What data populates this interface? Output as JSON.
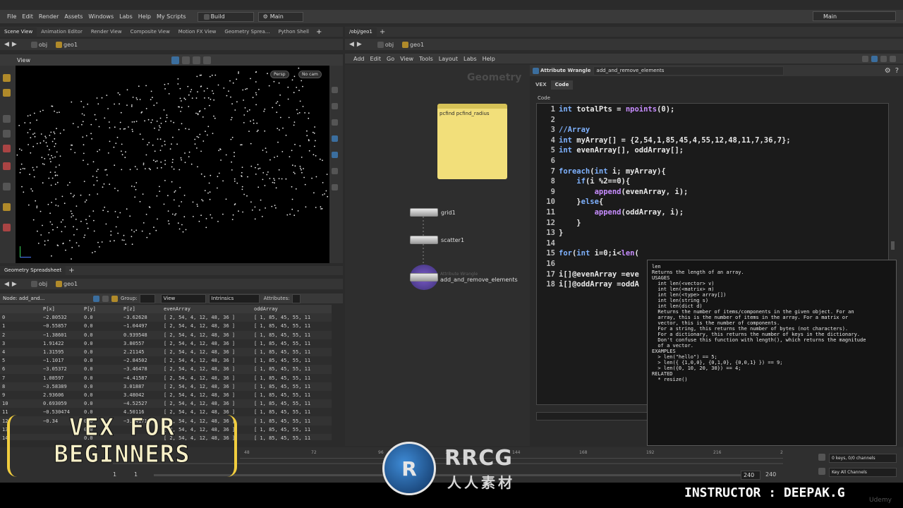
{
  "main_menu": {
    "items": [
      "File",
      "Edit",
      "Render",
      "Assets",
      "Windows",
      "Labs",
      "Help",
      "My Scripts"
    ],
    "desktop": "Build",
    "main_label": "Main",
    "right_desktop": "Main"
  },
  "left_tabs": [
    "Scene View",
    "Animation Editor",
    "Render View",
    "Composite View",
    "Motion FX View",
    "Geometry Sprea...",
    "Python Shell"
  ],
  "left_path": {
    "root": "obj",
    "node": "geo1"
  },
  "viewport": {
    "label": "View",
    "persp": "Persp",
    "nocam": "No cam"
  },
  "spreadsheet": {
    "tab": "Geometry Spreadsheet",
    "path_root": "obj",
    "path_node": "geo1",
    "node_label": "Node: add_and...",
    "group_label": "Group:",
    "view_label": "View",
    "intrinsics_label": "Intrinsics",
    "attributes_label": "Attributes:",
    "columns": [
      "",
      "P[x]",
      "P[y]",
      "P[z]",
      "evenArray",
      "oddArray"
    ],
    "rows": [
      [
        "0",
        "−2.80532",
        "0.0",
        "−3.62628",
        "[ 2, 54, 4, 12, 48, 36 ]",
        "[ 1, 85, 45, 55, 11"
      ],
      [
        "1",
        "−0.55857",
        "0.0",
        "−1.04497",
        "[ 2, 54, 4, 12, 48, 36 ]",
        "[ 1, 85, 45, 55, 11"
      ],
      [
        "2",
        "−1.38601",
        "0.0",
        "0.939548",
        "[ 2, 54, 4, 12, 48, 36 ]",
        "[ 1, 85, 45, 55, 11"
      ],
      [
        "3",
        "1.91422",
        "0.0",
        "3.80557",
        "[ 2, 54, 4, 12, 48, 36 ]",
        "[ 1, 85, 45, 55, 11"
      ],
      [
        "4",
        "1.31595",
        "0.0",
        "2.21145",
        "[ 2, 54, 4, 12, 48, 36 ]",
        "[ 1, 85, 45, 55, 11"
      ],
      [
        "5",
        "−1.1017",
        "0.0",
        "−2.84502",
        "[ 2, 54, 4, 12, 48, 36 ]",
        "[ 1, 85, 45, 55, 11"
      ],
      [
        "6",
        "−3.05372",
        "0.0",
        "−3.46478",
        "[ 2, 54, 4, 12, 48, 36 ]",
        "[ 1, 85, 45, 55, 11"
      ],
      [
        "7",
        "1.08597",
        "0.0",
        "−4.41587",
        "[ 2, 54, 4, 12, 48, 36 ]",
        "[ 1, 85, 45, 55, 11"
      ],
      [
        "8",
        "−3.58389",
        "0.0",
        "3.01887",
        "[ 2, 54, 4, 12, 48, 36 ]",
        "[ 1, 85, 45, 55, 11"
      ],
      [
        "9",
        "2.93606",
        "0.0",
        "3.48042",
        "[ 2, 54, 4, 12, 48, 36 ]",
        "[ 1, 85, 45, 55, 11"
      ],
      [
        "10",
        "0.693059",
        "0.0",
        "−4.52527",
        "[ 2, 54, 4, 12, 48, 36 ]",
        "[ 1, 85, 45, 55, 11"
      ],
      [
        "11",
        "−0.530474",
        "0.0",
        "4.50116",
        "[ 2, 54, 4, 12, 48, 36 ]",
        "[ 1, 85, 45, 55, 11"
      ],
      [
        "12",
        "−0.34",
        "0.0",
        "−3.64171",
        "[ 2, 54, 4, 12, 48, 36 ]",
        "[ 1, 85, 45, 55, 11"
      ],
      [
        "13",
        "",
        "0.0",
        "",
        "[ 2, 54, 4, 12, 48, 36 ]",
        "[ 1, 85, 45, 55, 11"
      ],
      [
        "14",
        "",
        "0.0",
        "",
        "[ 2, 54, 4, 12, 48, 36 ]",
        "[ 1, 85, 45, 55, 11"
      ]
    ]
  },
  "network": {
    "tab": "/obj/geo1",
    "path_root": "obj",
    "path_node": "geo1",
    "menu": [
      "Add",
      "Edit",
      "Go",
      "View",
      "Tools",
      "Layout",
      "Labs",
      "Help"
    ],
    "context_label": "Geometry",
    "sticky_note": "pcfind pcfind_radius",
    "nodes": [
      {
        "name": "grid1"
      },
      {
        "name": "scatter1"
      },
      {
        "name": "add_and_remove_elements",
        "type": "Attribute Wrangle"
      }
    ]
  },
  "params": {
    "type": "Attribute Wrangle",
    "name": "add_and_remove_elements",
    "tabs": [
      "VEX",
      "Code"
    ],
    "code_label": "Code",
    "code_lines": [
      {
        "n": "1",
        "t": "int totalPts = npoints(0);"
      },
      {
        "n": "2",
        "t": ""
      },
      {
        "n": "3",
        "t": "//Array"
      },
      {
        "n": "4",
        "t": "int myArray[] = {2,54,1,85,45,4,55,12,48,11,7,36,7};"
      },
      {
        "n": "5",
        "t": "int evenArray[], oddArray[];"
      },
      {
        "n": "6",
        "t": ""
      },
      {
        "n": "7",
        "t": "foreach(int i; myArray){"
      },
      {
        "n": "8",
        "t": "    if(i %2==0){"
      },
      {
        "n": "9",
        "t": "        append(evenArray, i);"
      },
      {
        "n": "10",
        "t": "    }else{"
      },
      {
        "n": "11",
        "t": "        append(oddArray, i);"
      },
      {
        "n": "12",
        "t": "    }"
      },
      {
        "n": "13",
        "t": "}"
      },
      {
        "n": "14",
        "t": ""
      },
      {
        "n": "15",
        "t": "for(int i=0;i<len("
      },
      {
        "n": "16",
        "t": ""
      },
      {
        "n": "17",
        "t": "i[]@evenArray =eve"
      },
      {
        "n": "18",
        "t": "i[]@oddArray =oddA"
      }
    ]
  },
  "popup": {
    "lines": [
      "len",
      "",
      "Returns the length of an array.",
      "",
      "USAGES",
      "  int len(<vector> v)",
      "  int len(<matrix> m)",
      "  int len(<type> array[])",
      "  int len(string s)",
      "  int len(dict d)",
      "  Returns the number of items/components in the given object. For an",
      "  array, this is the number of items in the array. For a matrix or",
      "  vector, this is the number of components.",
      "",
      "  For a string, this returns the number of bytes (not characters).",
      "",
      "  For a dictionary, this returns the number of keys in the dictionary.",
      "",
      "  Don't confuse this function with length(), which returns the magnitude",
      "  of a vector.",
      "",
      "EXAMPLES",
      "",
      "  > len(\"hello\") == 5;",
      "  > len({ {1,0,0}, {0,1,0}, {0,0,1} }) == 9;",
      "  > len({0, 10, 20, 30}) == 4;",
      "",
      "RELATED",
      "",
      "",
      "  * resize()"
    ]
  },
  "timeline": {
    "ticks": [
      "48",
      "72",
      "96",
      "120",
      "144",
      "168",
      "192",
      "216",
      "2"
    ],
    "frame_a": "1",
    "frame_b": "1",
    "end_a": "240",
    "end_b": "240",
    "keys": "0 keys, 0/0 channels",
    "key_all": "Key All Channels"
  },
  "overlay": {
    "course_title_line1": "VEX FOR",
    "course_title_line2": "BEGINNERS",
    "watermark_main": "RRCG",
    "watermark_sub": "人人素材",
    "instructor": "INSTRUCTOR : DEEPAK.G",
    "udemy": "Udemy"
  }
}
